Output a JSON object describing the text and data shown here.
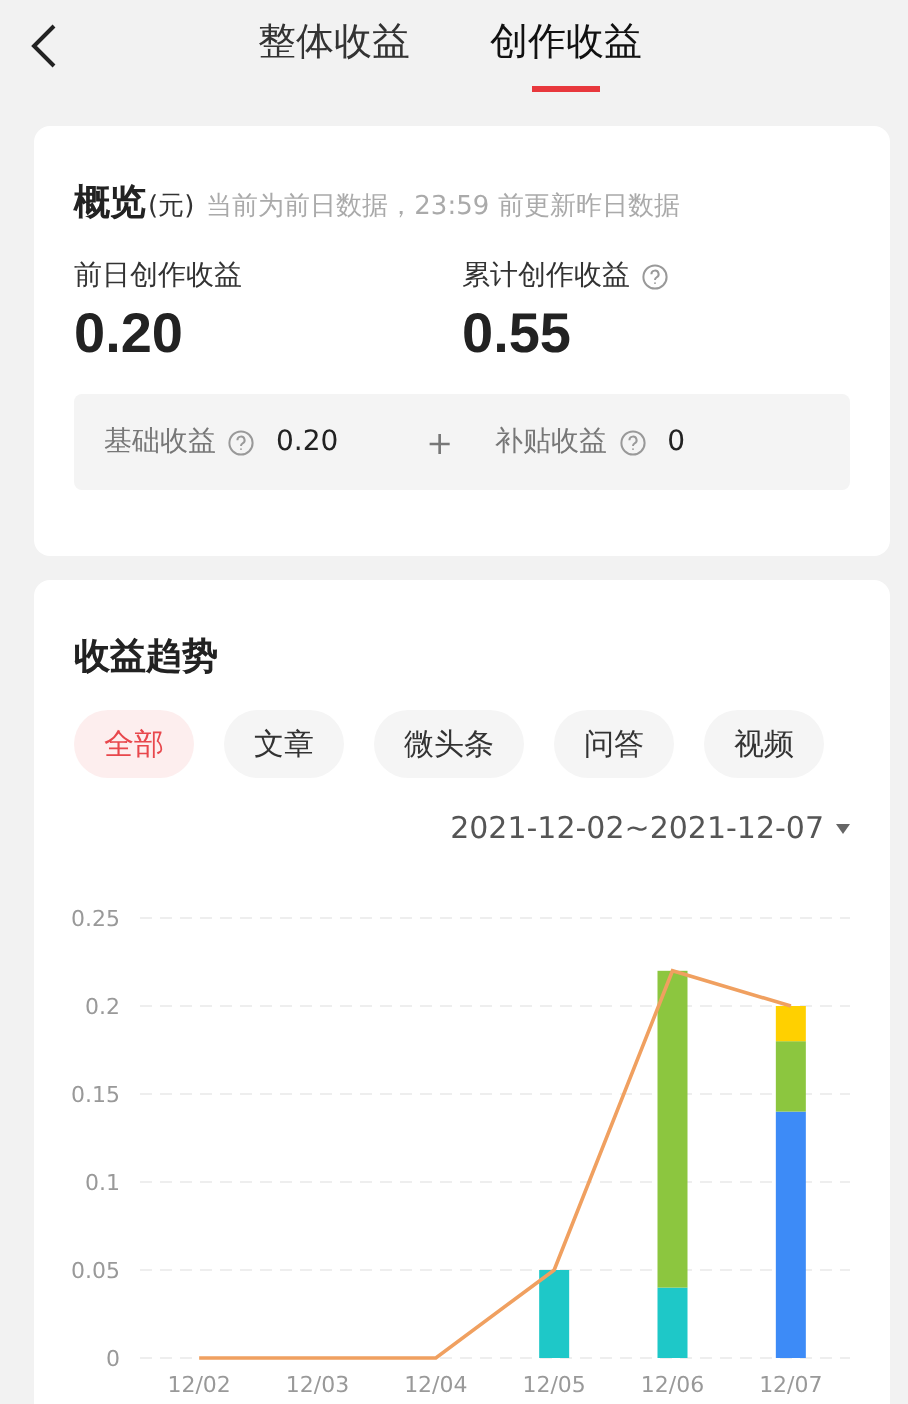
{
  "header": {
    "tabs": [
      {
        "label": "整体收益",
        "selected": false
      },
      {
        "label": "创作收益",
        "selected": true
      }
    ]
  },
  "overview": {
    "title": "概览",
    "unit": "(元)",
    "note": "当前为前日数据，23:59 前更新昨日数据",
    "stats": [
      {
        "label": "前日创作收益",
        "value": "0.20",
        "help": false
      },
      {
        "label": "累计创作收益",
        "value": "0.55",
        "help": true
      }
    ],
    "breakdown": [
      {
        "label": "基础收益",
        "value": "0.20"
      },
      {
        "label": "补贴收益",
        "value": "0"
      }
    ],
    "operator": "+"
  },
  "trend": {
    "title": "收益趋势",
    "filters": [
      {
        "label": "全部",
        "selected": true
      },
      {
        "label": "文章",
        "selected": false
      },
      {
        "label": "微头条",
        "selected": false
      },
      {
        "label": "问答",
        "selected": false
      },
      {
        "label": "视频",
        "selected": false
      }
    ],
    "date_range": "2021-12-02~2021-12-07",
    "chart_data": {
      "type": "bar",
      "stacked": true,
      "categories": [
        "12/02",
        "12/03",
        "12/04",
        "12/05",
        "12/06",
        "12/07"
      ],
      "series": [
        {
          "color": "#1ec8c8",
          "values": [
            0,
            0,
            0,
            0.05,
            0.04,
            0
          ]
        },
        {
          "color": "#3d8bf7",
          "values": [
            0,
            0,
            0,
            0,
            0,
            0.14
          ]
        },
        {
          "color": "#8cc63f",
          "values": [
            0,
            0,
            0,
            0,
            0.18,
            0.04
          ]
        },
        {
          "color": "#ffd000",
          "values": [
            0,
            0,
            0,
            0,
            0,
            0.02
          ]
        },
        {
          "type": "line",
          "color": "#f0a060",
          "values": [
            0,
            0,
            0,
            0.05,
            0.22,
            0.2
          ]
        }
      ],
      "grid": true,
      "ylim": [
        0,
        0.25
      ],
      "yticks": [
        0,
        0.05,
        0.1,
        0.15,
        0.2,
        0.25
      ]
    }
  }
}
